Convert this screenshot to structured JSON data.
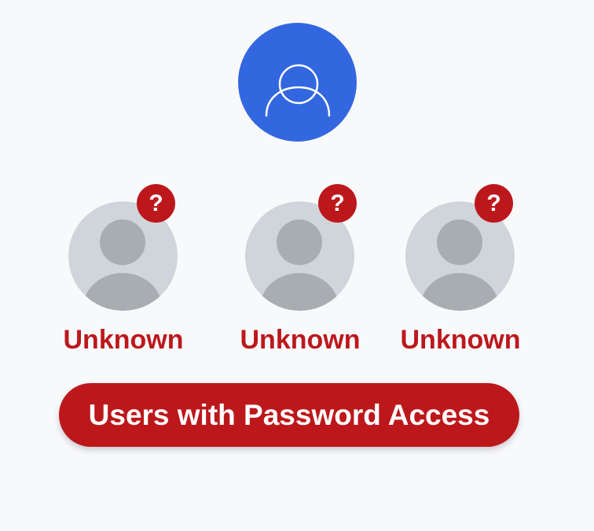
{
  "owner": {
    "icon": "user-outline-icon",
    "color": "#3367e0"
  },
  "users": [
    {
      "label": "Unknown",
      "badge": "?",
      "icon": "user-placeholder-icon"
    },
    {
      "label": "Unknown",
      "badge": "?",
      "icon": "user-placeholder-icon"
    },
    {
      "label": "Unknown",
      "badge": "?",
      "icon": "user-placeholder-icon"
    }
  ],
  "banner": {
    "text": "Users with Password Access"
  },
  "colors": {
    "accent_red": "#bc181c",
    "avatar_gray": "#d0d5db",
    "avatar_dark_gray": "#a7adb1",
    "background": "#f8f9fb"
  }
}
